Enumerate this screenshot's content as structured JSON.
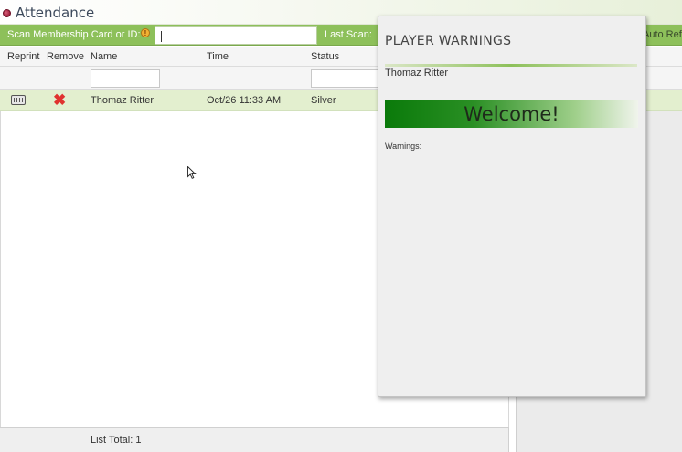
{
  "window": {
    "title": "Attendance"
  },
  "scanbar": {
    "scan_label": "Scan Membership Card or ID:",
    "scan_value": "",
    "last_scan_label": "Last Scan:",
    "auto_refresh_label": "Auto Refr"
  },
  "grid": {
    "columns": {
      "reprint": "Reprint",
      "remove": "Remove",
      "name": "Name",
      "time": "Time",
      "status": "Status"
    },
    "rows": [
      {
        "name": "Thomaz Ritter",
        "time": "Oct/26 11:33 AM",
        "status": "Silver"
      }
    ],
    "footer": {
      "list_total": "List Total: 1"
    }
  },
  "popup": {
    "title": "PLAYER WARNINGS",
    "player_name": "Thomaz Ritter",
    "welcome": "Welcome!",
    "warnings_label": "Warnings:"
  },
  "colors": {
    "scanbar": "#8dc05a",
    "row_highlight": "#e3efcf",
    "welcome_green": "#0a7a0a",
    "remove_red": "#e0322f"
  },
  "icons": {
    "app": "attendance-icon",
    "info": "info-icon",
    "reprint": "printer-icon",
    "remove": "close-x-icon",
    "cursor": "mouse-pointer-icon"
  }
}
